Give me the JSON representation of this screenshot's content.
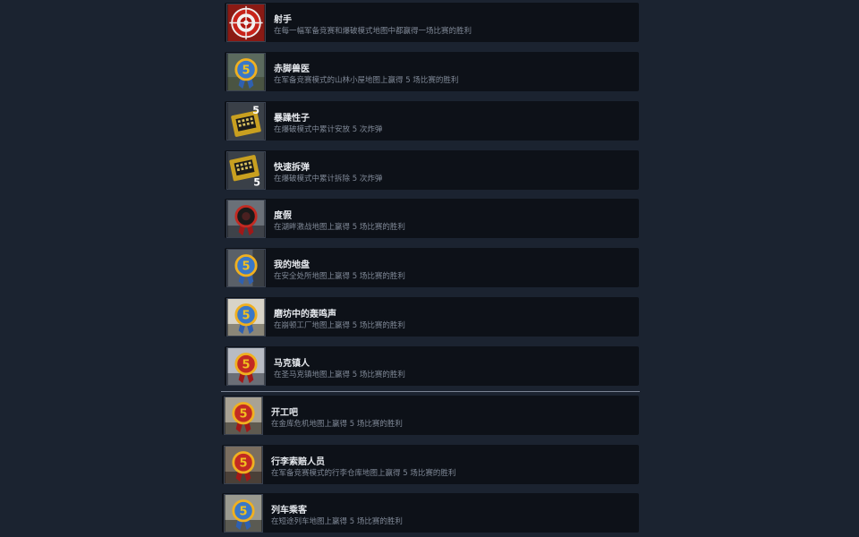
{
  "achievements": [
    {
      "title": "射手",
      "desc": "在每一幅军备竞赛和爆破模式地图中都赢得一场比赛的胜利",
      "icon": "target-icon"
    },
    {
      "title": "赤脚兽医",
      "desc": "在军备竞赛模式的山林小屋地图上赢得 5 场比赛的胜利",
      "icon": "blue-medal-icon"
    },
    {
      "title": "暴躁性子",
      "desc": "在爆破模式中累计安放 5 次炸弹",
      "icon": "bomb-plant-icon"
    },
    {
      "title": "快速拆弹",
      "desc": "在爆破模式中累计拆除 5 次炸弹",
      "icon": "bomb-defuse-icon"
    },
    {
      "title": "度假",
      "desc": "在湖畔激战地图上赢得 5 场比赛的胜利",
      "icon": "red-medal-icon"
    },
    {
      "title": "我的地盘",
      "desc": "在安全处所地图上赢得 5 场比赛的胜利",
      "icon": "blue-medal-icon"
    },
    {
      "title": "磨坊中的轰鸣声",
      "desc": "在崩顿工厂地图上赢得 5 场比赛的胜利",
      "icon": "blue-medal-icon"
    },
    {
      "title": "马克镇人",
      "desc": "在圣马克镇地图上赢得 5 场比赛的胜利",
      "icon": "red-medal-icon"
    },
    {
      "title": "开工吧",
      "desc": "在金库危机地图上赢得 5 场比赛的胜利",
      "icon": "red-medal-icon"
    },
    {
      "title": "行李索赔人员",
      "desc": "在军备竞赛模式的行李仓库地图上赢得 5 场比赛的胜利",
      "icon": "red-medal-icon"
    },
    {
      "title": "列车乘客",
      "desc": "在短途列车地图上赢得 5 场比赛的胜利",
      "icon": "blue-medal-icon"
    }
  ],
  "badge_number": "5",
  "colors": {
    "page_bg": "#1b2330",
    "row_bg": "#0d1118",
    "title": "#e6e9ee",
    "desc": "#7f8896",
    "medal_blue": "#3a78c8",
    "medal_red": "#c22a22",
    "medal_gold": "#f0b020"
  }
}
